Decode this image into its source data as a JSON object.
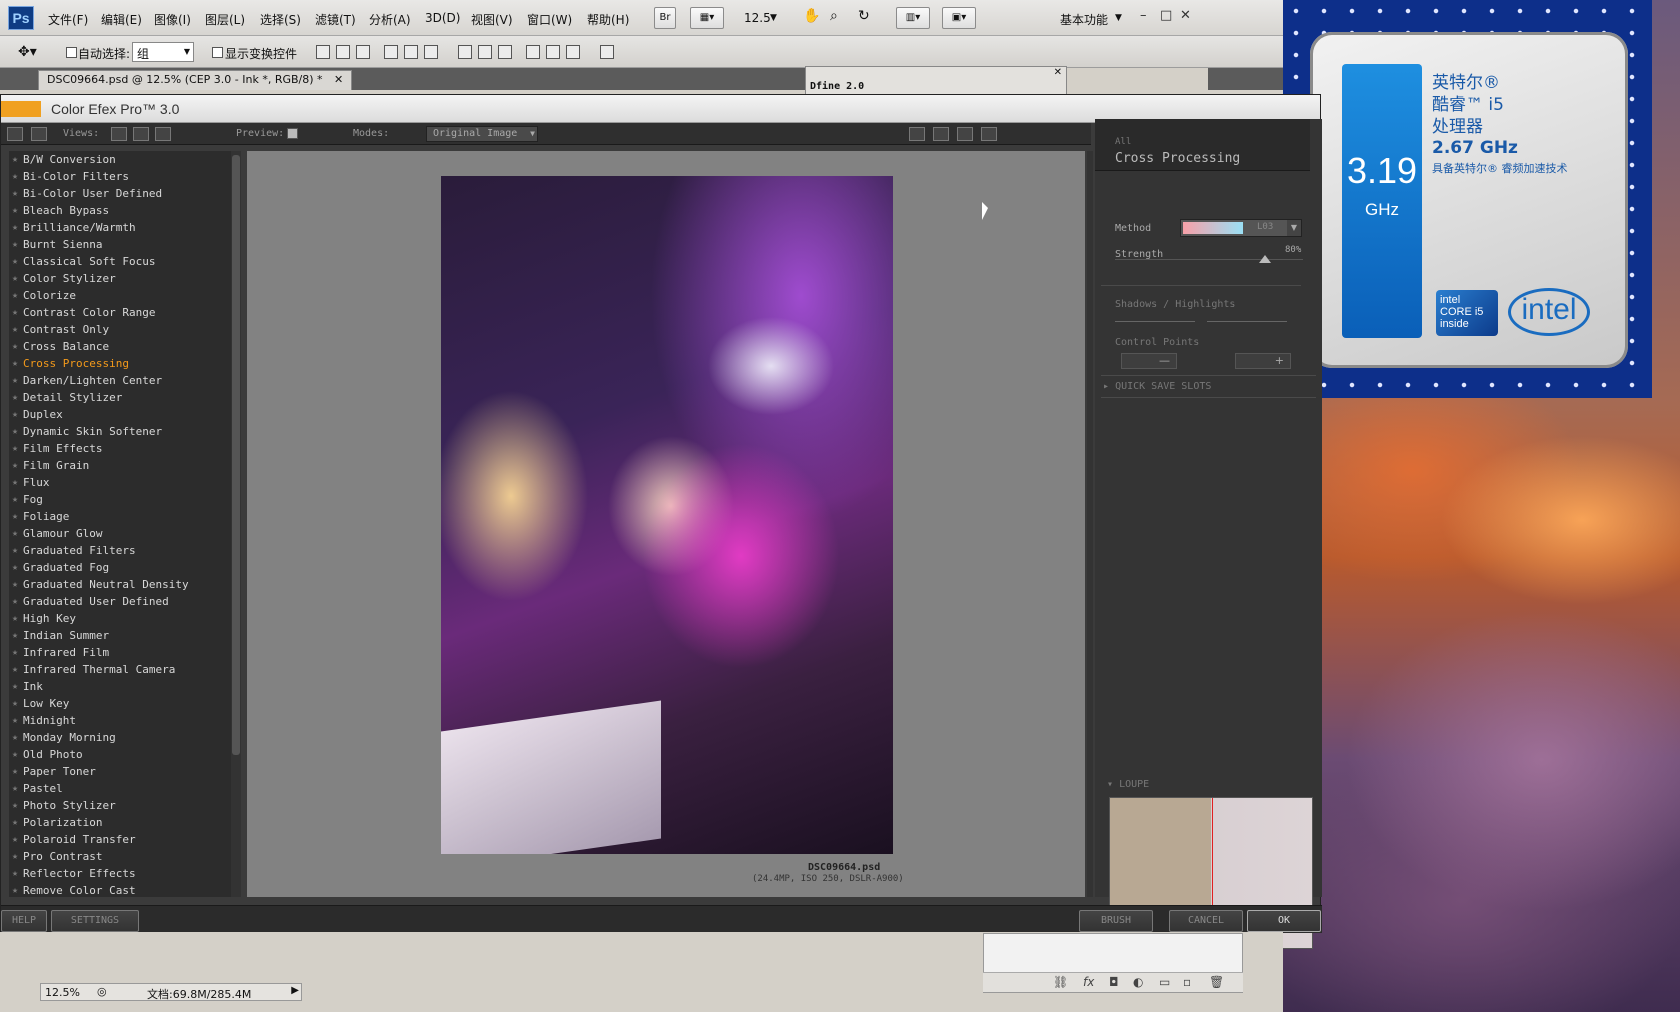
{
  "photoshop": {
    "menu": [
      "文件(F)",
      "编辑(E)",
      "图像(I)",
      "图层(L)",
      "选择(S)",
      "滤镜(T)",
      "分析(A)",
      "3D(D)",
      "视图(V)",
      "窗口(W)",
      "帮助(H)"
    ],
    "bridge_button": "Br",
    "zoom_menu": "12.5",
    "workspace": "基本功能",
    "options": {
      "auto_select_label": "自动选择:",
      "auto_select_value": "组",
      "show_transform_label": "显示变换控件"
    },
    "document_tab": "DSC09664.psd @ 12.5% (CEP 3.0 - Ink *, RGB/8) *",
    "dfine_panel_title": "Dfine 2.0",
    "status": {
      "zoom": "12.5%",
      "doc_size": "文档:69.8M/285.4M"
    }
  },
  "color_efex": {
    "title": "Color Efex Pro™ 3.0",
    "toolbar": {
      "views_label": "Views:",
      "preview_label": "Preview:",
      "modes_label": "Modes:",
      "modes_value": "Original Image"
    },
    "filters": [
      "B/W Conversion",
      "Bi-Color Filters",
      "Bi-Color User Defined",
      "Bleach Bypass",
      "Brilliance/Warmth",
      "Burnt Sienna",
      "Classical Soft Focus",
      "Color Stylizer",
      "Colorize",
      "Contrast Color Range",
      "Contrast Only",
      "Cross Balance",
      "Cross Processing",
      "Darken/Lighten Center",
      "Detail Stylizer",
      "Duplex",
      "Dynamic Skin Softener",
      "Film Effects",
      "Film Grain",
      "Flux",
      "Fog",
      "Foliage",
      "Glamour Glow",
      "Graduated Filters",
      "Graduated Fog",
      "Graduated Neutral Density",
      "Graduated User Defined",
      "High Key",
      "Indian Summer",
      "Infrared Film",
      "Infrared Thermal Camera",
      "Ink",
      "Low Key",
      "Midnight",
      "Monday Morning",
      "Old Photo",
      "Paper Toner",
      "Pastel",
      "Photo Stylizer",
      "Polarization",
      "Polaroid Transfer",
      "Pro Contrast",
      "Reflector Effects",
      "Remove Color Cast"
    ],
    "selected_filter_index": 12,
    "photo": {
      "filename": "DSC09664.psd",
      "meta": "(24.4MP, ISO 250, DSLR-A900)"
    },
    "controls": {
      "category": "All",
      "filter_name": "Cross Processing",
      "method_label": "Method",
      "method_value": "L03",
      "strength_label": "Strength",
      "strength_value": "80%",
      "strength_fraction": 0.8,
      "shadows_highlights": "Shadows / Highlights",
      "control_points": "Control Points",
      "quick_save": "QUICK SAVE SLOTS",
      "loupe": "LOUPE"
    },
    "buttons": {
      "help": "HELP",
      "settings": "SETTINGS",
      "brush": "BRUSH",
      "cancel": "CANCEL",
      "ok": "OK"
    }
  },
  "cpu_wallpaper": {
    "ghz_big": "3.19",
    "ghz_unit": "GHz",
    "brand_line1": "英特尔®",
    "brand_line2": "酷睿™ i5",
    "brand_line3": "处理器",
    "freq": "2.67 GHz",
    "turbo": "具备英特尔® 睿频加速技术",
    "badge_text": "intel CORE i5 inside",
    "logo_text": "intel"
  }
}
